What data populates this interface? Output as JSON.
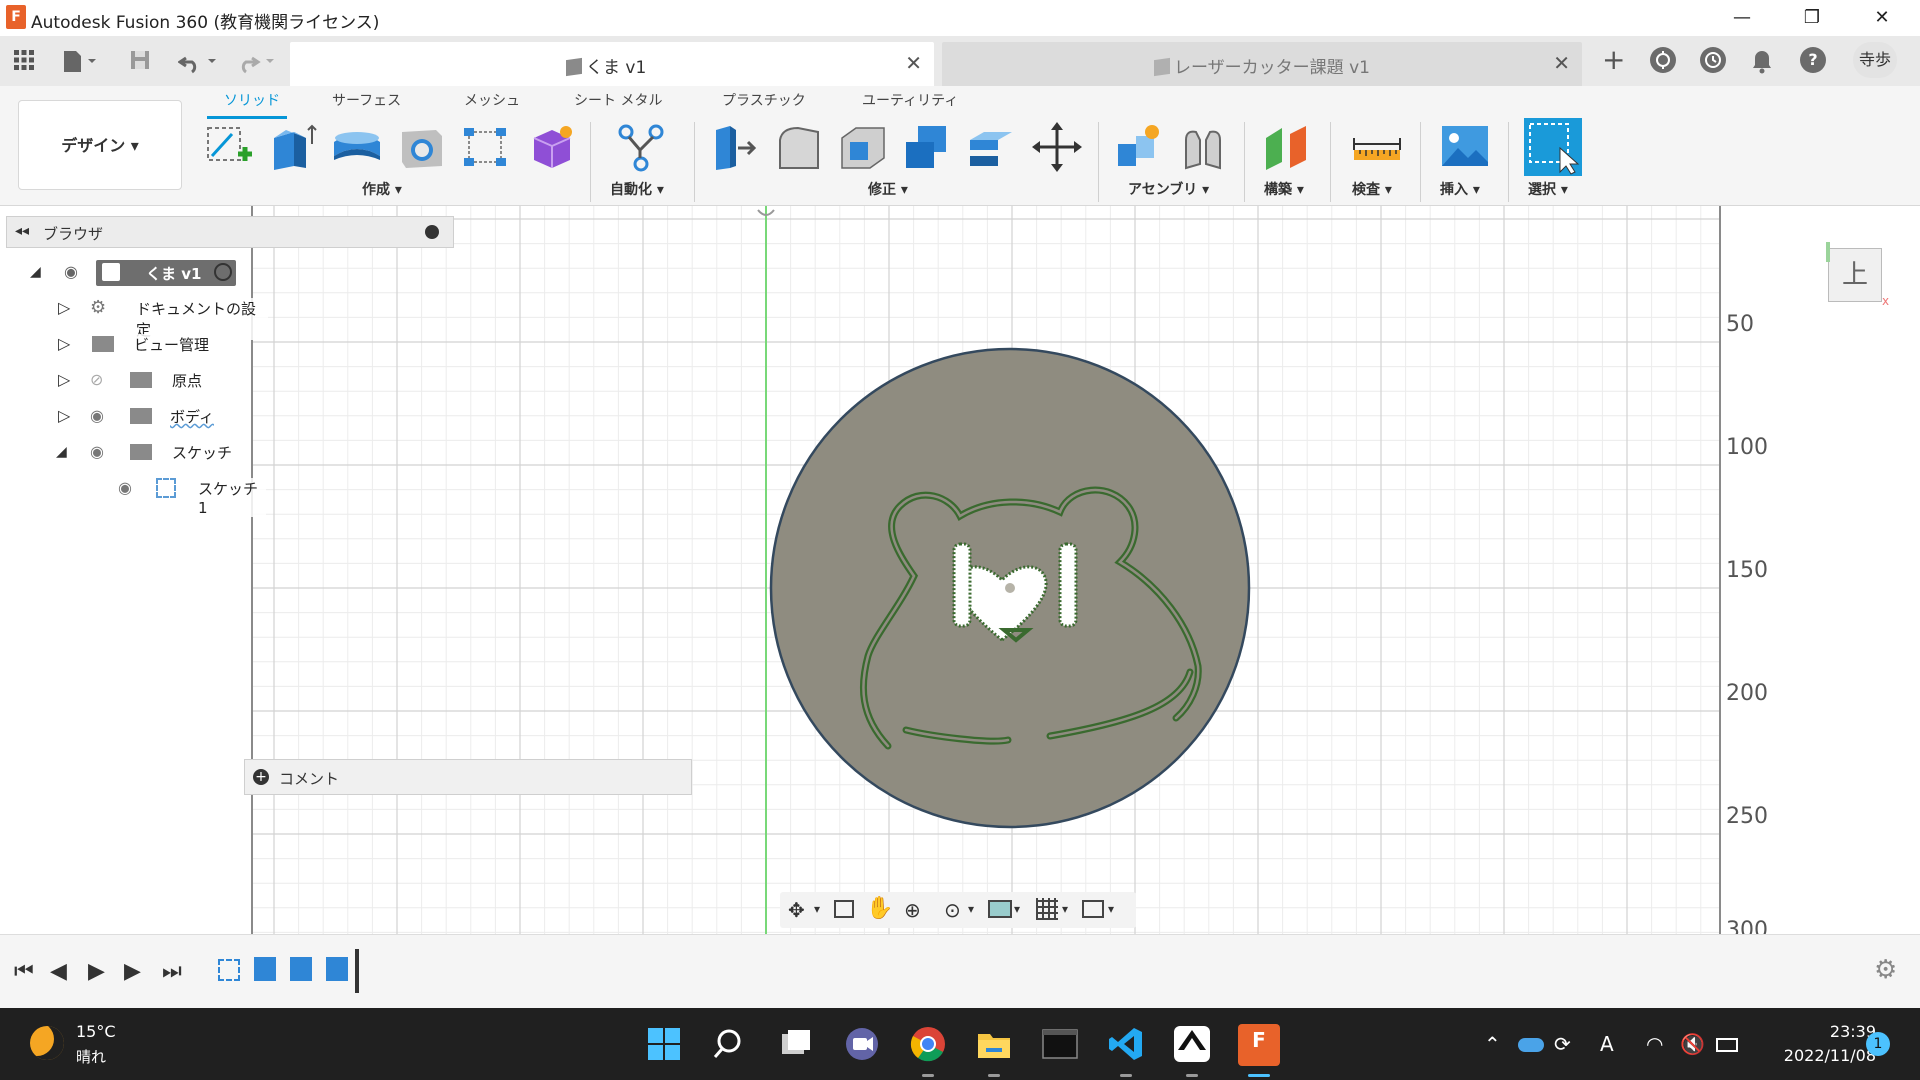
{
  "window": {
    "title": "Autodesk Fusion 360 (教育機関ライセンス)",
    "app_logo_letter": "F",
    "minimize_glyph": "—",
    "maximize_glyph": "❐",
    "close_glyph": "✕"
  },
  "tabs": {
    "active": {
      "label": "くま v1"
    },
    "inactive": {
      "label": "レーザーカッター課題 v1"
    },
    "close_glyph": "✕",
    "new_tab_glyph": "+"
  },
  "header_right": {
    "user_initials": "寺歩",
    "help_glyph": "?"
  },
  "ribbon": {
    "workspace": "デザイン ▾",
    "tabs": [
      "ソリッド",
      "サーフェス",
      "メッシュ",
      "シート メタル",
      "プラスチック",
      "ユーティリティ"
    ],
    "active_tab_index": 0,
    "groups": [
      "作成 ▾",
      "自動化 ▾",
      "修正 ▾",
      "アセンブリ ▾",
      "構築 ▾",
      "検査 ▾",
      "挿入 ▾",
      "選択 ▾"
    ]
  },
  "browser": {
    "title": "ブラウザ",
    "root": "くま v1",
    "items": [
      {
        "label": "ドキュメントの設定"
      },
      {
        "label": "ビュー管理"
      },
      {
        "label": "原点"
      },
      {
        "label": "ボディ"
      },
      {
        "label": "スケッチ"
      },
      {
        "label": "スケッチ1"
      }
    ]
  },
  "comment": {
    "label": "コメント"
  },
  "ruler": {
    "labels": [
      "50",
      "100",
      "150",
      "200",
      "250",
      "300"
    ]
  },
  "viewcube": {
    "face": "上"
  },
  "taskbar": {
    "weather_temp": "15°C",
    "weather_condition": "晴れ",
    "time": "23:39",
    "date": "2022/11/08",
    "notifications": "1",
    "ime": "A"
  },
  "colors": {
    "accent": "#0696d7",
    "model_fill": "#8f8c80",
    "model_edge": "#34495e",
    "sketch_line": "#3a6a2f",
    "grid": "#d8d8d8",
    "axis_green": "#78d878"
  }
}
